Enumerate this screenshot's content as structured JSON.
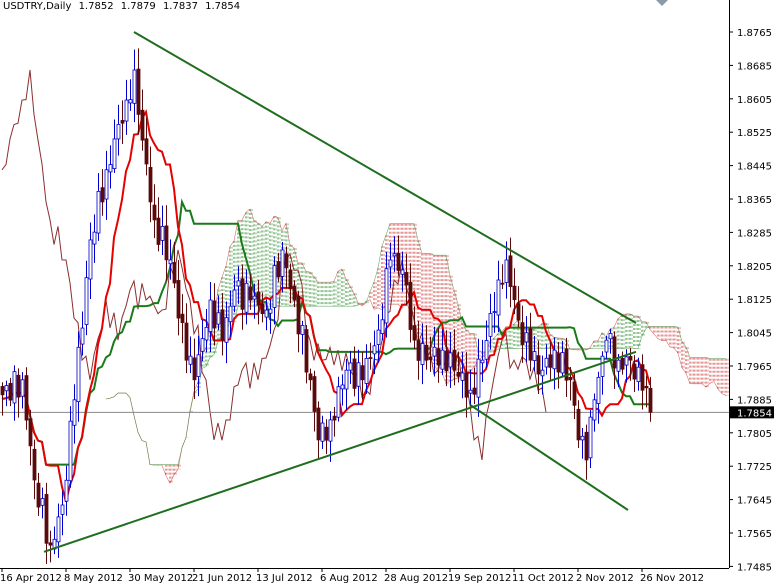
{
  "header": {
    "symbol": "USDTRY,Daily",
    "open": "1.7852",
    "high": "1.7879",
    "low": "1.7837",
    "close": "1.7854"
  },
  "colors": {
    "tenkan": "#e60000",
    "kijun": "#1a7a1a",
    "chikou": "#8b2e2e",
    "bull": "#0000cc",
    "bear": "#5a0a0a",
    "cloud_bull": "#2e8b2e",
    "cloud_bear": "#cc3333",
    "trendline": "#1e6e1e",
    "price_line": "#888888"
  },
  "chart_data": {
    "type": "candlestick",
    "title": "USDTRY,Daily",
    "indicator": "Ichimoku Kinko Hyo (9, 26, 52)",
    "ylim": [
      1.7485,
      1.8805
    ],
    "price_ticks": [
      "1.8765",
      "1.8685",
      "1.8605",
      "1.8525",
      "1.8445",
      "1.8365",
      "1.8285",
      "1.8205",
      "1.8125",
      "1.8045",
      "1.7965",
      "1.7885",
      "1.7805",
      "1.7725",
      "1.7645",
      "1.7565",
      "1.7485"
    ],
    "current_price": "1.7854",
    "date_labels": [
      {
        "bar": 0,
        "label": "16 Apr 2012"
      },
      {
        "bar": 16,
        "label": "8 May 2012"
      },
      {
        "bar": 32,
        "label": "30 May 2012"
      },
      {
        "bar": 48,
        "label": "21 Jun 2012"
      },
      {
        "bar": 64,
        "label": "13 Jul 2012"
      },
      {
        "bar": 80,
        "label": "6 Aug 2012"
      },
      {
        "bar": 96,
        "label": "28 Aug 2012"
      },
      {
        "bar": 112,
        "label": "19 Sep 2012"
      },
      {
        "bar": 128,
        "label": "11 Oct 2012"
      },
      {
        "bar": 144,
        "label": "2 Nov 2012"
      },
      {
        "bar": 160,
        "label": "26 Nov 2012"
      }
    ],
    "bar_count": 163,
    "close_keypoints": [
      [
        0,
        1.7896
      ],
      [
        5,
        1.7932
      ],
      [
        8,
        1.7692
      ],
      [
        12,
        1.7536
      ],
      [
        15,
        1.7632
      ],
      [
        18,
        1.7884
      ],
      [
        22,
        1.8267
      ],
      [
        26,
        1.8435
      ],
      [
        31,
        1.8602
      ],
      [
        33,
        1.8674
      ],
      [
        35,
        1.8506
      ],
      [
        38,
        1.8315
      ],
      [
        42,
        1.8219
      ],
      [
        46,
        1.7979
      ],
      [
        48,
        1.7932
      ],
      [
        52,
        1.8123
      ],
      [
        55,
        1.8027
      ],
      [
        58,
        1.8147
      ],
      [
        62,
        1.8123
      ],
      [
        66,
        1.8099
      ],
      [
        70,
        1.8243
      ],
      [
        73,
        1.8123
      ],
      [
        77,
        1.7932
      ],
      [
        79,
        1.7788
      ],
      [
        82,
        1.7836
      ],
      [
        86,
        1.7955
      ],
      [
        90,
        1.7932
      ],
      [
        94,
        1.8051
      ],
      [
        97,
        1.8219
      ],
      [
        100,
        1.8195
      ],
      [
        103,
        1.8027
      ],
      [
        106,
        1.7979
      ],
      [
        110,
        1.8003
      ],
      [
        113,
        1.7955
      ],
      [
        117,
        1.7907
      ],
      [
        120,
        1.7979
      ],
      [
        124,
        1.8171
      ],
      [
        126,
        1.8219
      ],
      [
        129,
        1.8075
      ],
      [
        132,
        1.7979
      ],
      [
        135,
        1.7955
      ],
      [
        138,
        1.8003
      ],
      [
        142,
        1.7932
      ],
      [
        144,
        1.7788
      ],
      [
        146,
        1.774
      ],
      [
        148,
        1.7884
      ],
      [
        151,
        1.8027
      ],
      [
        154,
        1.7979
      ],
      [
        157,
        1.7979
      ],
      [
        160,
        1.7907
      ],
      [
        162,
        1.7854
      ]
    ],
    "trendlines": [
      {
        "name": "upper-resistance",
        "from": [
          33,
          1.8765
        ],
        "to": [
          158.5,
          1.8068
        ]
      },
      {
        "name": "rising-support",
        "from": [
          10.5,
          1.752
        ],
        "to": [
          158.5,
          1.7999
        ]
      },
      {
        "name": "falling-channel",
        "from": [
          117,
          1.7872
        ],
        "to": [
          156.5,
          1.762
        ]
      }
    ]
  }
}
